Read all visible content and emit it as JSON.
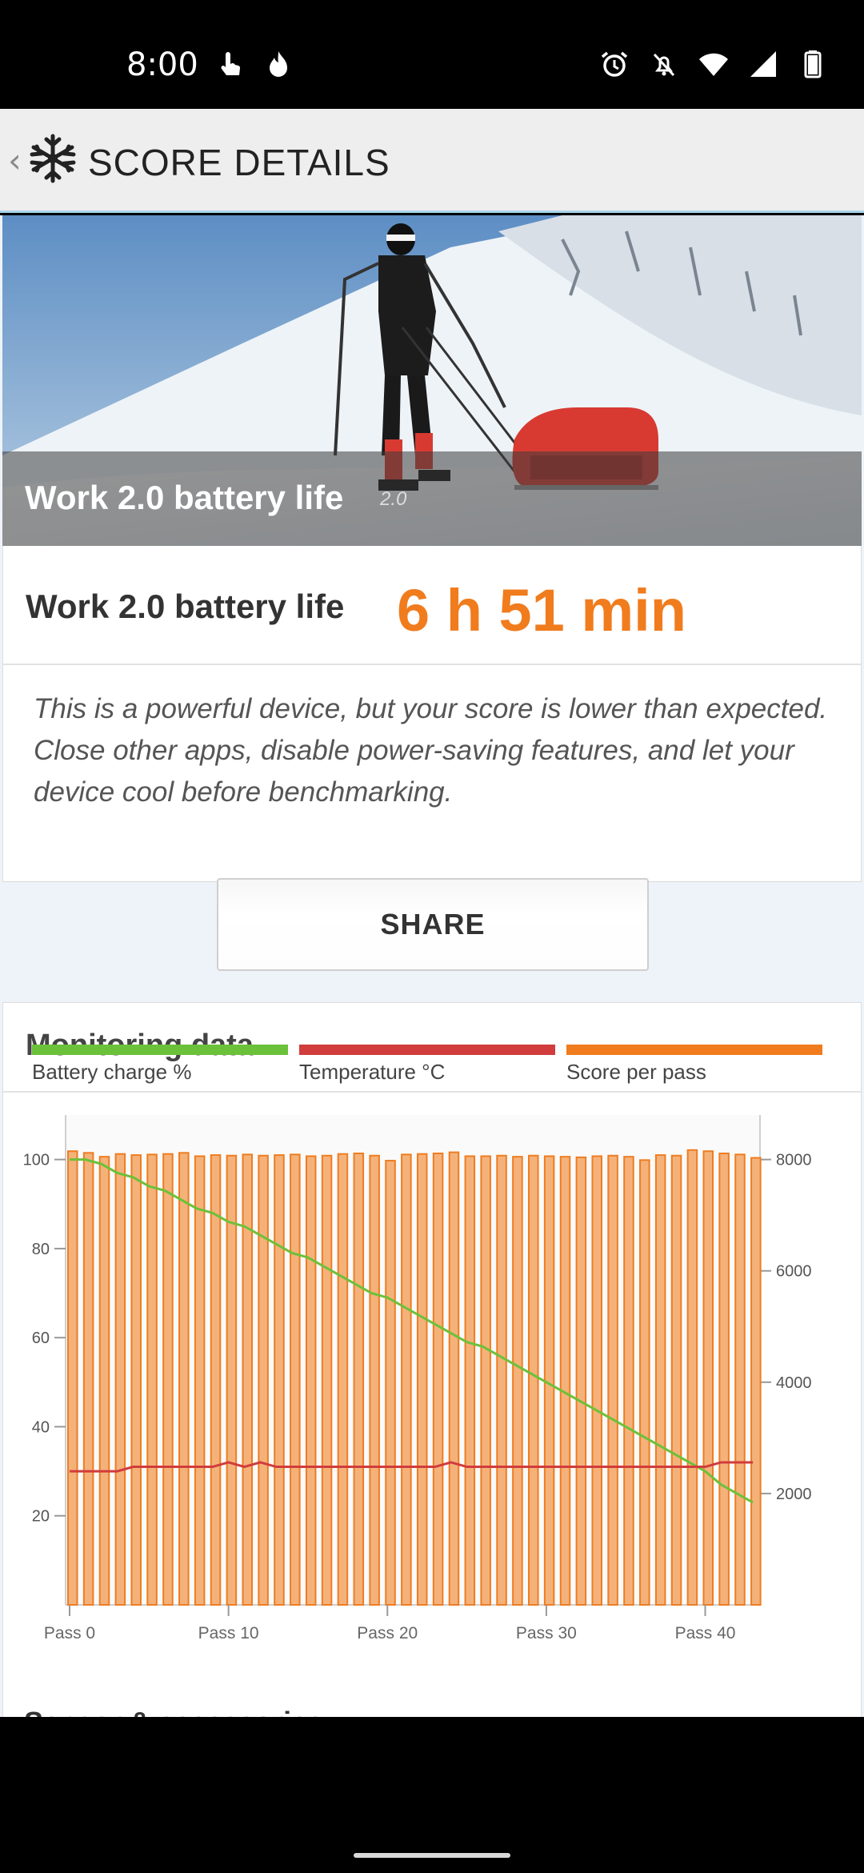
{
  "status_bar": {
    "time": "8:00",
    "left_icons": [
      "touch-icon",
      "flame-icon"
    ],
    "right_icons": [
      "alarm-icon",
      "notifications-off-icon",
      "wifi-icon",
      "signal-icon",
      "battery-icon"
    ]
  },
  "header": {
    "title": "SCORE DETAILS",
    "logo_icon": "snowflake-logo-icon",
    "back_icon": "chevron-left-icon"
  },
  "hero": {
    "title": "Work 2.0 battery life",
    "version": "2.0"
  },
  "score": {
    "label": "Work 2.0 battery life",
    "value": "6 h 51 min",
    "message": "This is a powerful device, but your score is lower than expected. Close other apps, disable power-saving features, and let your device cool before benchmarking."
  },
  "share": {
    "label": "SHARE"
  },
  "monitoring": {
    "title": "Monitoring data",
    "legend": [
      {
        "label": "Battery charge %",
        "color": "#6cc13a"
      },
      {
        "label": "Temperature °C",
        "color": "#d13c3c"
      },
      {
        "label": "Score per pass",
        "color": "#f07c1e"
      }
    ]
  },
  "chart_data": {
    "type": "bar",
    "x_tick_labels": [
      "Pass 0",
      "Pass 10",
      "Pass 20",
      "Pass 30",
      "Pass 40"
    ],
    "left_axis": {
      "ticks": [
        20,
        40,
        60,
        80,
        100
      ],
      "range": [
        0,
        110
      ]
    },
    "right_axis": {
      "ticks": [
        2000,
        4000,
        6000,
        8000
      ],
      "range": [
        0,
        8800
      ]
    },
    "series": [
      {
        "name": "Score per pass",
        "axis": "right",
        "x": [
          0,
          1,
          2,
          3,
          4,
          5,
          6,
          7,
          8,
          9,
          10,
          11,
          12,
          13,
          14,
          15,
          16,
          17,
          18,
          19,
          20,
          21,
          22,
          23,
          24,
          25,
          26,
          27,
          28,
          29,
          30,
          31,
          32,
          33,
          34,
          35,
          36,
          37,
          38,
          39,
          40,
          41,
          42,
          43
        ],
        "values": [
          8150,
          8120,
          8050,
          8100,
          8080,
          8090,
          8100,
          8120,
          8060,
          8080,
          8070,
          8090,
          8070,
          8080,
          8090,
          8060,
          8070,
          8100,
          8110,
          8070,
          7980,
          8090,
          8100,
          8110,
          8130,
          8060,
          8060,
          8070,
          8050,
          8070,
          8060,
          8050,
          8040,
          8060,
          8070,
          8050,
          7990,
          8080,
          8070,
          8170,
          8150,
          8110,
          8090,
          8030
        ]
      },
      {
        "name": "Battery charge %",
        "axis": "left",
        "x": [
          0,
          1,
          2,
          3,
          4,
          5,
          6,
          7,
          8,
          9,
          10,
          11,
          12,
          13,
          14,
          15,
          16,
          17,
          18,
          19,
          20,
          21,
          22,
          23,
          24,
          25,
          26,
          27,
          28,
          29,
          30,
          31,
          32,
          33,
          34,
          35,
          36,
          37,
          38,
          39,
          40,
          41,
          42,
          43
        ],
        "values": [
          100,
          100,
          99,
          97,
          96,
          94,
          93,
          91,
          89,
          88,
          86,
          85,
          83,
          81,
          79,
          78,
          76,
          74,
          72,
          70,
          69,
          67,
          65,
          63,
          61,
          59,
          58,
          56,
          54,
          52,
          50,
          48,
          46,
          44,
          42,
          40,
          38,
          36,
          34,
          32,
          30,
          27,
          25,
          23
        ]
      },
      {
        "name": "Temperature °C",
        "axis": "left",
        "x": [
          0,
          1,
          2,
          3,
          4,
          5,
          6,
          7,
          8,
          9,
          10,
          11,
          12,
          13,
          14,
          15,
          16,
          17,
          18,
          19,
          20,
          21,
          22,
          23,
          24,
          25,
          26,
          27,
          28,
          29,
          30,
          31,
          32,
          33,
          34,
          35,
          36,
          37,
          38,
          39,
          40,
          41,
          42,
          43
        ],
        "values": [
          30,
          30,
          30,
          30,
          31,
          31,
          31,
          31,
          31,
          31,
          32,
          31,
          32,
          31,
          31,
          31,
          31,
          31,
          31,
          31,
          31,
          31,
          31,
          31,
          32,
          31,
          31,
          31,
          31,
          31,
          31,
          31,
          31,
          31,
          31,
          31,
          31,
          31,
          31,
          31,
          31,
          32,
          32,
          32
        ]
      }
    ]
  },
  "next_section": {
    "title": "Sensor & accessories"
  }
}
